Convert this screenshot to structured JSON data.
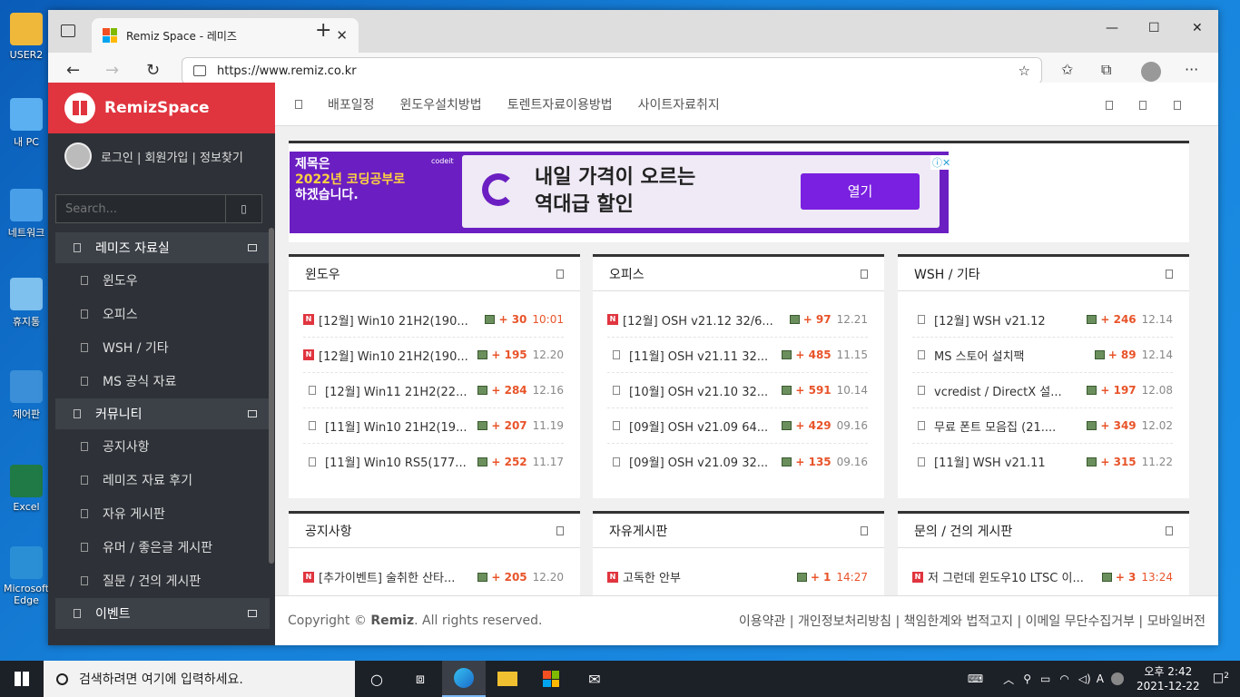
{
  "desktop": {
    "icons": [
      {
        "label": "USER2",
        "color": "#f0b83a"
      },
      {
        "label": "내 PC",
        "color": "#5ab0f0"
      },
      {
        "label": "네트워크",
        "color": "#4aa0e8"
      },
      {
        "label": "휴지통",
        "color": "#7ec0ee"
      },
      {
        "label": "제어판",
        "color": "#3a8fd8"
      },
      {
        "label": "Excel",
        "color": "#1f7a45"
      },
      {
        "label": "Microsoft Edge",
        "color": "#2b8fd6"
      }
    ]
  },
  "browser": {
    "tab_title": "Remiz Space - 레미즈",
    "tab_close": "✕",
    "new_tab": "+",
    "url": "https://www.remiz.co.kr",
    "controls": {
      "minimize": "—",
      "maximize": "☐",
      "close": "✕"
    },
    "nav": {
      "back": "←",
      "forward": "→",
      "refresh": "↻"
    },
    "toolbar": {
      "favorite": "☆",
      "favorites": "✩",
      "collections": "⧉",
      "more": "···"
    }
  },
  "site": {
    "brand": "RemizSpace",
    "user_links": "로그인 | 회원가입 | 정보찾기",
    "search_placeholder": "Search...",
    "menu": [
      {
        "type": "cat",
        "label": "레미즈 자료실"
      },
      {
        "type": "item",
        "label": "윈도우"
      },
      {
        "type": "item",
        "label": "오피스"
      },
      {
        "type": "item",
        "label": "WSH / 기타"
      },
      {
        "type": "item",
        "label": "MS 공식 자료"
      },
      {
        "type": "cat",
        "label": "커뮤니티"
      },
      {
        "type": "item",
        "label": "공지사항"
      },
      {
        "type": "item",
        "label": "레미즈 자료 후기"
      },
      {
        "type": "item",
        "label": "자유 게시판"
      },
      {
        "type": "item",
        "label": "유머 / 좋은글 게시판"
      },
      {
        "type": "item",
        "label": "질문 / 건의 게시판"
      },
      {
        "type": "cat",
        "label": "이벤트"
      }
    ],
    "topnav": [
      "배포일정",
      "윈도우설치방법",
      "토렌트자료이용방법",
      "사이트자료취지"
    ],
    "ad": {
      "left_lines": [
        "제목은",
        "2022년 코딩공부로",
        "하겠습니다."
      ],
      "brand_small": "codeit",
      "headline_1": "내일 가격이 오르는",
      "headline_2": "역대급 할인",
      "button": "열기",
      "adchoice": "ⓘ✕"
    },
    "cards": [
      {
        "title": "윈도우",
        "posts": [
          {
            "new": true,
            "title": "[12월] Win10 21H2(190...",
            "count": "+ 30",
            "date": "10:01",
            "date_red": true
          },
          {
            "new": true,
            "title": "[12월] Win10 21H2(190...",
            "count": "+ 195",
            "date": "12.20"
          },
          {
            "new": false,
            "title": "[12월] Win11 21H2(22...",
            "count": "+ 284",
            "date": "12.16"
          },
          {
            "new": false,
            "title": "[11월] Win10 21H2(19...",
            "count": "+ 207",
            "date": "11.19"
          },
          {
            "new": false,
            "title": "[11월] Win10 RS5(177...",
            "count": "+ 252",
            "date": "11.17"
          }
        ]
      },
      {
        "title": "오피스",
        "posts": [
          {
            "new": true,
            "title": "[12월] OSH v21.12 32/6...",
            "count": "+ 97",
            "date": "12.21"
          },
          {
            "new": false,
            "title": "[11월] OSH v21.11 32...",
            "count": "+ 485",
            "date": "11.15"
          },
          {
            "new": false,
            "title": "[10월] OSH v21.10 32...",
            "count": "+ 591",
            "date": "10.14"
          },
          {
            "new": false,
            "title": "[09월] OSH v21.09 64...",
            "count": "+ 429",
            "date": "09.16"
          },
          {
            "new": false,
            "title": "[09월] OSH v21.09 32...",
            "count": "+ 135",
            "date": "09.16"
          }
        ]
      },
      {
        "title": "WSH / 기타",
        "posts": [
          {
            "new": false,
            "title": "[12월] WSH v21.12",
            "count": "+ 246",
            "date": "12.14"
          },
          {
            "new": false,
            "title": "MS 스토어 설치팩",
            "count": "+ 89",
            "date": "12.14"
          },
          {
            "new": false,
            "title": "vcredist / DirectX 설...",
            "count": "+ 197",
            "date": "12.08"
          },
          {
            "new": false,
            "title": "무료 폰트 모음집 (21....",
            "count": "+ 349",
            "date": "12.02"
          },
          {
            "new": false,
            "title": "[11월] WSH v21.11",
            "count": "+ 315",
            "date": "11.22"
          }
        ]
      },
      {
        "title": "공지사항",
        "posts": [
          {
            "new": true,
            "title": "[추가이벤트] 술취한 산타...",
            "count": "+ 205",
            "date": "12.20"
          }
        ]
      },
      {
        "title": "자유게시판",
        "posts": [
          {
            "new": true,
            "title": "고독한 안부",
            "count": "+ 1",
            "date": "14:27",
            "date_red": true
          }
        ]
      },
      {
        "title": "문의 / 건의 게시판",
        "posts": [
          {
            "new": true,
            "title": "저 그런데 윈도우10 LTSC 이...",
            "count": "+ 3",
            "date": "13:24",
            "date_red": true
          }
        ]
      }
    ],
    "footer": {
      "copyright_prefix": "Copyright ©",
      "copyright_brand": "Remiz",
      "copyright_suffix": ". All rights reserved.",
      "links": "이용약관 | 개인정보처리방침 | 책임한계와 법적고지 | 이메일 무단수집거부 | 모바일버전"
    }
  },
  "taskbar": {
    "search_placeholder": "검색하려면 여기에 입력하세요.",
    "time": "오후 2:42",
    "date": "2021-12-22",
    "notifications": "2"
  },
  "colors": {
    "brand_red": "#e0353f",
    "sidebar": "#2e3238",
    "accent_orange": "#e8542a",
    "ad_purple": "#6b1fc2"
  }
}
